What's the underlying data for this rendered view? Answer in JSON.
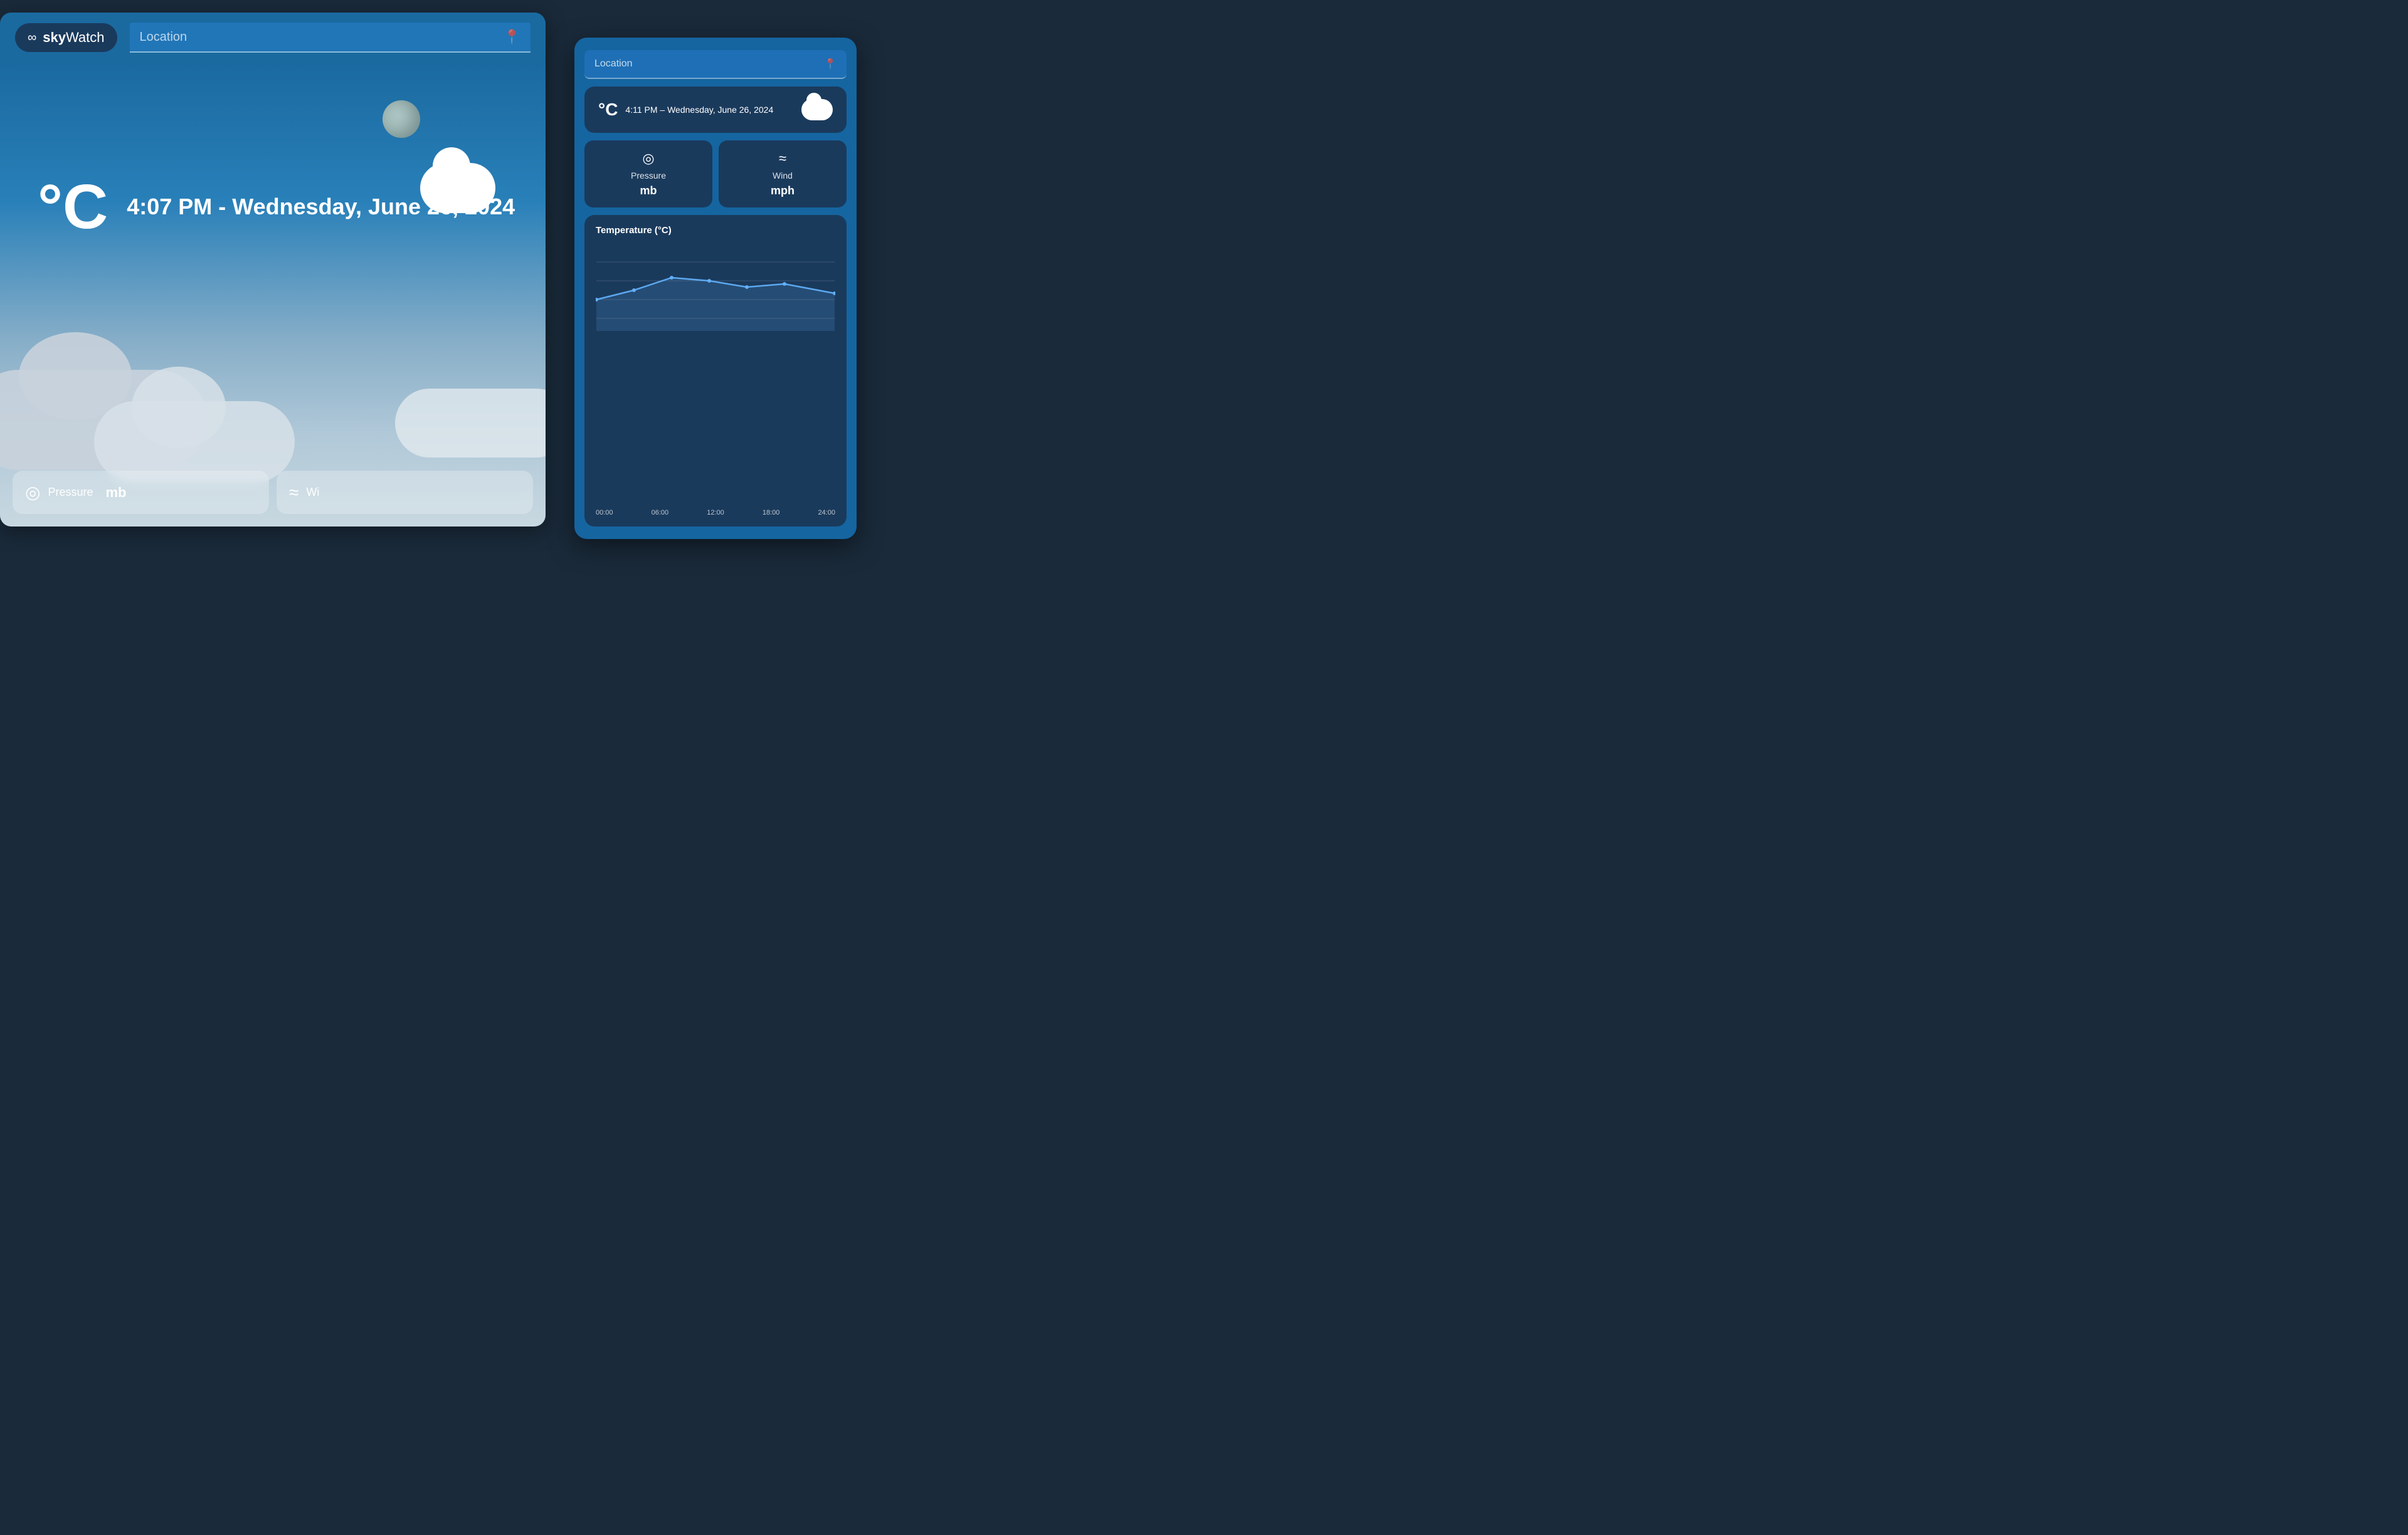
{
  "app": {
    "name": "skyWatch",
    "logo_symbol": "∞"
  },
  "bg_window": {
    "location_placeholder": "Location",
    "datetime": "4:07 PM - Wednesday, June 26, 2024",
    "temp_unit": "°C",
    "pressure_label": "Pressure",
    "pressure_value": "mb",
    "wind_label": "Wi",
    "pressure_icon": "◎",
    "wind_icon": "≈"
  },
  "fg_window": {
    "location_placeholder": "Location",
    "current": {
      "temp_unit": "°C",
      "datetime": "4:11 PM – Wednesday, June 26, 2024"
    },
    "pressure": {
      "label": "Pressure",
      "value": "mb",
      "icon": "◎"
    },
    "wind": {
      "label": "Wind",
      "value": "mph",
      "icon": "≈"
    },
    "chart": {
      "title": "Temperature (°C)",
      "x_labels": [
        "00:00",
        "06:00",
        "12:00",
        "18:00",
        "24:00"
      ]
    }
  }
}
